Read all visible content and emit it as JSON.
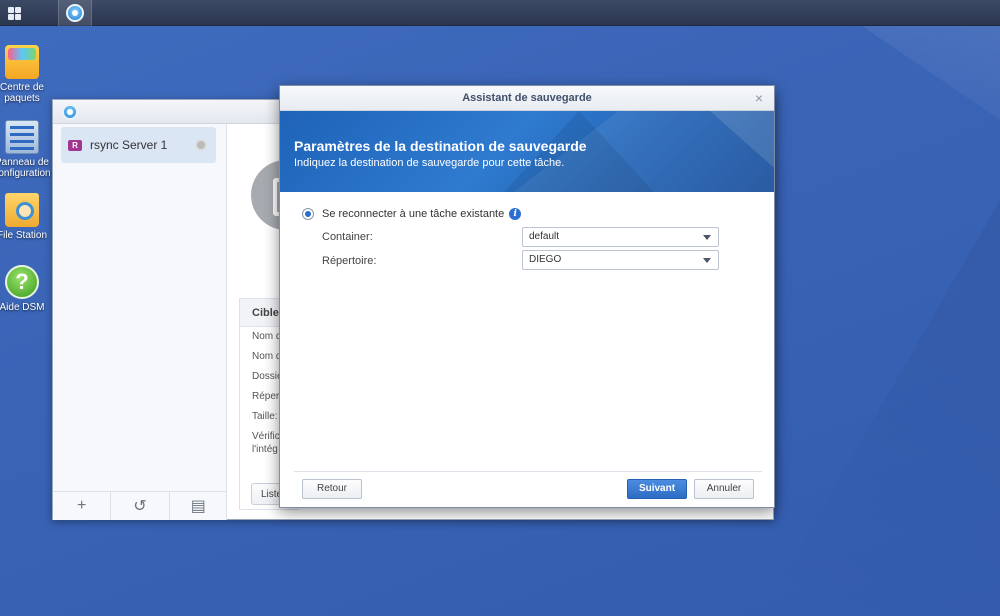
{
  "desktop": {
    "icons": [
      {
        "label": "Centre de paquets",
        "icon": "package-center-icon"
      },
      {
        "label": "Panneau de configuration",
        "icon": "control-panel-icon"
      },
      {
        "label": "File Station",
        "icon": "file-station-icon"
      },
      {
        "label": "Aide DSM",
        "icon": "help-icon"
      }
    ]
  },
  "bg_window": {
    "sidebar_item": "rsync Server 1",
    "sidebar_item_badge": "R",
    "info_header": "Cible",
    "info_rows": [
      "Nom d",
      "Nom d",
      "Dossie",
      "Répert",
      "Taille:",
      "Vérific",
      "l'intég"
    ],
    "list_button": "Liste"
  },
  "dialog": {
    "title": "Assistant de sauvegarde",
    "close": "×",
    "banner_title": "Paramètres de la destination de sauvegarde",
    "banner_subtitle": "Indiquez la destination de sauvegarde pour cette tâche.",
    "radio_label": "Se reconnecter à une tâche existante",
    "info_glyph": "i",
    "container_label": "Container:",
    "container_value": "default",
    "directory_label": "Répertoire:",
    "directory_value": "DIEGO",
    "back_button": "Retour",
    "next_button": "Suivant",
    "cancel_button": "Annuler"
  },
  "colors": {
    "desktop": "#3a64b6",
    "accent": "#2d6cc4",
    "banner": "#1e63b8"
  }
}
